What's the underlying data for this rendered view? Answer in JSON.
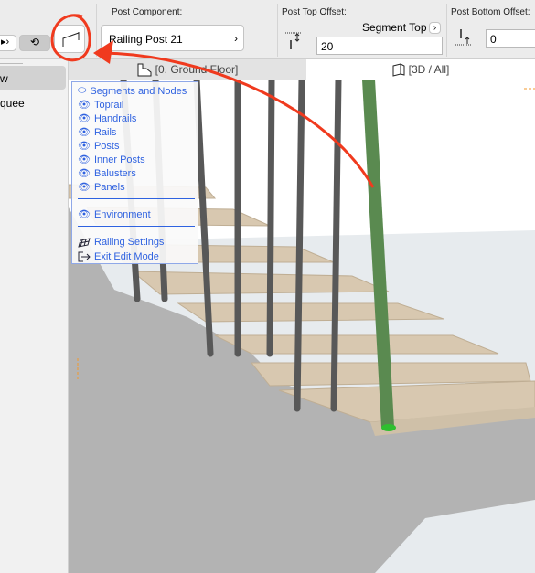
{
  "toolbar": {
    "post_component_label": "Post Component:",
    "post_component_value": "Railing Post 21",
    "post_top_offset_label": "Post Top Offset:",
    "post_top_reference": "Segment Top",
    "post_top_offset_value": "20",
    "post_bottom_offset_label": "Post Bottom Offset:",
    "post_bottom_offset_value": "0"
  },
  "sidebar": {
    "items": [
      {
        "label": "w",
        "selected": true
      },
      {
        "label": "quee"
      }
    ]
  },
  "tabs": [
    {
      "label": "[0. Ground Floor]",
      "icon": "floor-plan-icon"
    },
    {
      "label": "[3D / All]",
      "icon": "3d-box-icon"
    }
  ],
  "menu": {
    "items": [
      {
        "label": "Segments and Nodes",
        "icon": "eye-closed-icon"
      },
      {
        "label": "Toprail",
        "icon": "eye-icon"
      },
      {
        "label": "Handrails",
        "icon": "eye-icon"
      },
      {
        "label": "Rails",
        "icon": "eye-icon"
      },
      {
        "label": "Posts",
        "icon": "eye-icon"
      },
      {
        "label": "Inner Posts",
        "icon": "eye-icon"
      },
      {
        "label": "Balusters",
        "icon": "eye-icon"
      },
      {
        "label": "Panels",
        "icon": "eye-icon"
      }
    ],
    "environment": "Environment",
    "railing_settings": "Railing Settings",
    "exit_edit_mode": "Exit Edit Mode"
  },
  "colors": {
    "accent": "#2f62e0",
    "annotation": "#f03a1e",
    "selected_post": "#5a8a50"
  }
}
